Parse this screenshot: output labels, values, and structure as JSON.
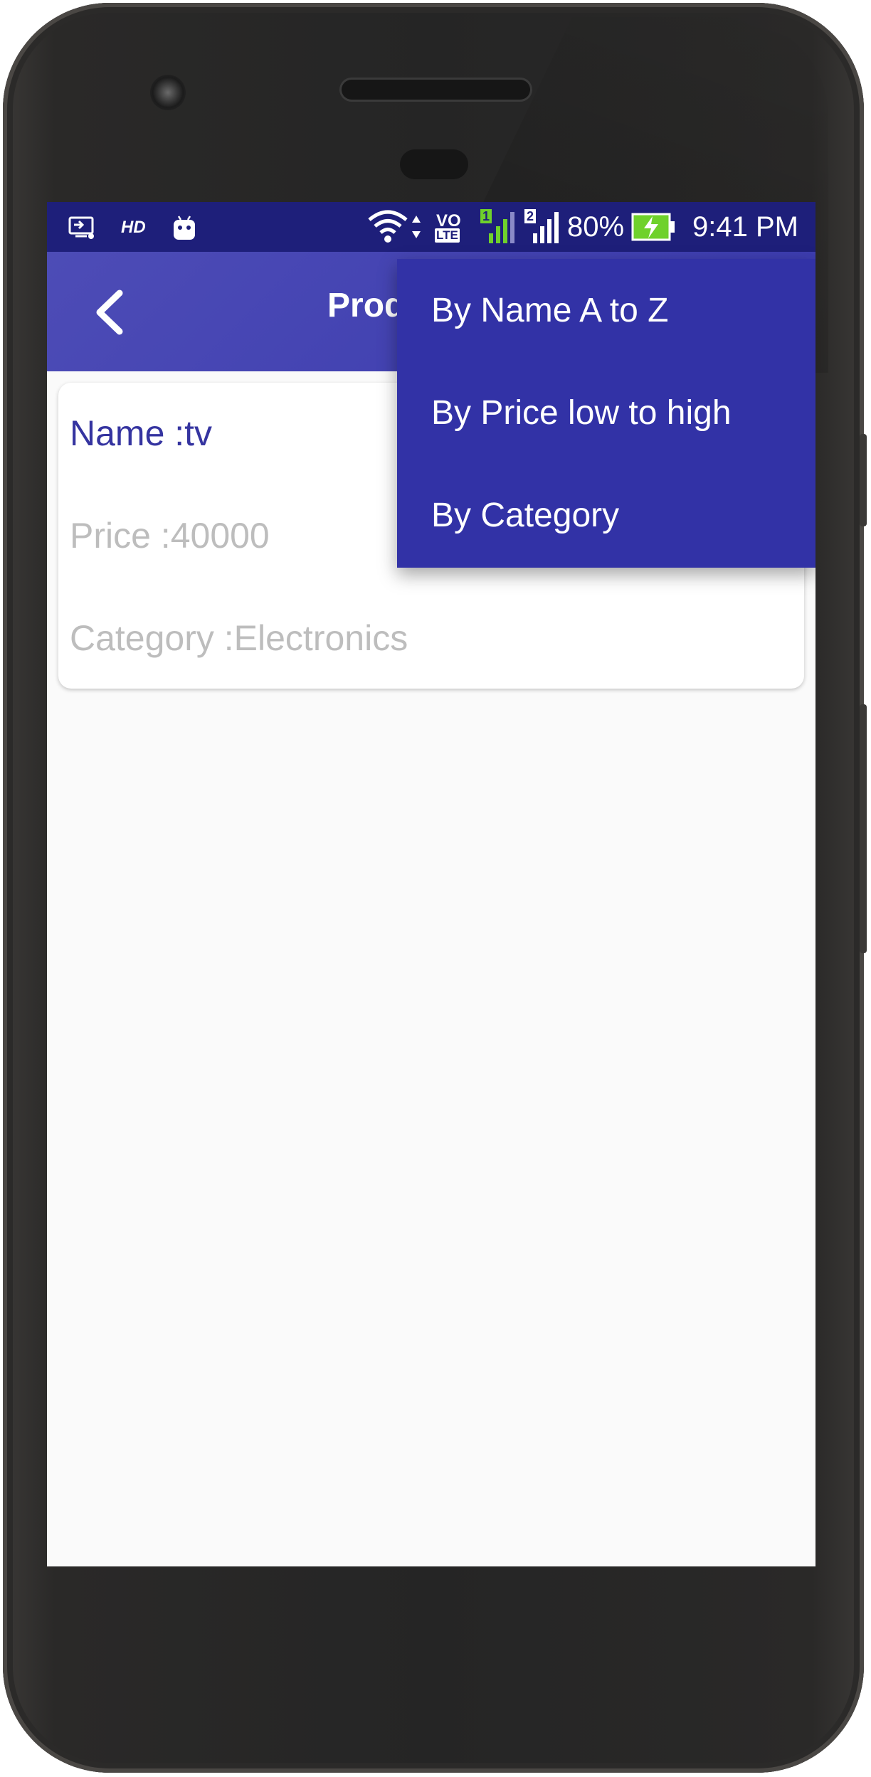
{
  "status_bar": {
    "hd_label": "HD",
    "sim1_label": "1",
    "sim2_label": "2",
    "volte_top": "VO",
    "volte_bottom": "LTE",
    "battery": "80%",
    "time": "9:41 PM"
  },
  "app_bar": {
    "title": "Products"
  },
  "product": {
    "name": "Name :tv",
    "price": "Price :40000",
    "category": "Category :Electronics"
  },
  "sort_menu": {
    "items": [
      {
        "label": "By Name A to Z"
      },
      {
        "label": "By Price low to high"
      },
      {
        "label": "By Category"
      }
    ]
  },
  "colors": {
    "status_bar": "#1e1f7a",
    "app_bar": "#3f3fb0",
    "menu": "#3232a6",
    "product_name": "#3534a0",
    "secondary_text": "#bdbdbd"
  }
}
